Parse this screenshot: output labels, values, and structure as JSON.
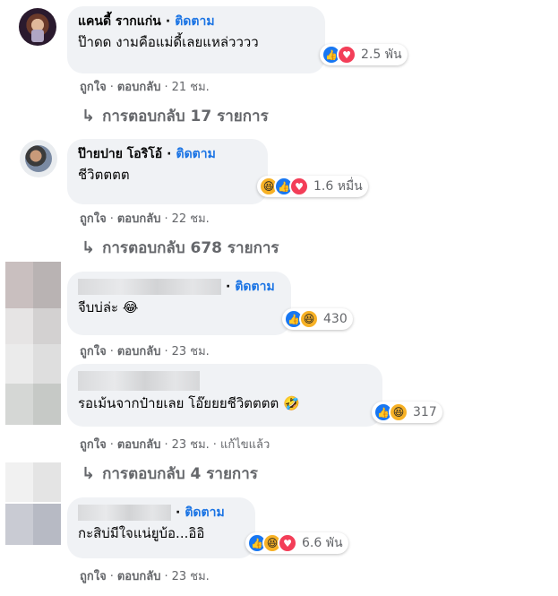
{
  "comments": [
    {
      "author": "แคนดี้ รากแก่น",
      "follow": "ติดตาม",
      "text": "ป๊าดด งามคือแม่ดี้เลยแหล่วววว",
      "reactions": [
        "like",
        "love"
      ],
      "reaction_count": "2.5 พัน",
      "like": "ถูกใจ",
      "reply": "ตอบกลับ",
      "time": "21 ชม.",
      "replies": "การตอบกลับ 17 รายการ"
    },
    {
      "author": "ป๊ายปาย โอริโอ้",
      "follow": "ติดตาม",
      "text": "ชีวิตตตต",
      "reactions": [
        "haha",
        "like",
        "love"
      ],
      "reaction_count": "1.6 หมื่น",
      "like": "ถูกใจ",
      "reply": "ตอบกลับ",
      "time": "22 ชม.",
      "replies": "การตอบกลับ 678 รายการ"
    },
    {
      "author": "",
      "follow": "ติดตาม",
      "text": "จีบบ่ล่ะ 😂",
      "reactions": [
        "like",
        "haha"
      ],
      "reaction_count": "430",
      "like": "ถูกใจ",
      "reply": "ตอบกลับ",
      "time": "23 ชม."
    },
    {
      "author": "",
      "text": "รอเม้นจากป๋ายเลย โอ๊ยยยชีวิตตตต 🤣",
      "reactions": [
        "like",
        "haha"
      ],
      "reaction_count": "317",
      "like": "ถูกใจ",
      "reply": "ตอบกลับ",
      "time": "23 ชม.",
      "edited": "แก้ไขแล้ว",
      "replies": "การตอบกลับ 4 รายการ"
    },
    {
      "author": "",
      "follow": "ติดตาม",
      "text": "กะสิบ่มีใจแน่ยูบ้อ...อิอิ",
      "reactions": [
        "like",
        "haha",
        "love"
      ],
      "reaction_count": "6.6 พัน",
      "like": "ถูกใจ",
      "reply": "ตอบกลับ",
      "time": "23 ชม."
    }
  ],
  "icons": {
    "like": "thumbs-up-icon",
    "love": "heart-icon",
    "haha": "laughing-face-icon",
    "reply_arrow": "reply-arrow-icon"
  },
  "colors": {
    "link": "#1b74e4",
    "bubble": "#f0f2f5",
    "muted": "#65676b",
    "like": "#1877f2",
    "love": "#f33e58",
    "haha": "#f7b125"
  },
  "glyphs": {
    "like": "👍",
    "love": "♥",
    "haha": "😆",
    "dot": "·",
    "arrow": "↳"
  }
}
